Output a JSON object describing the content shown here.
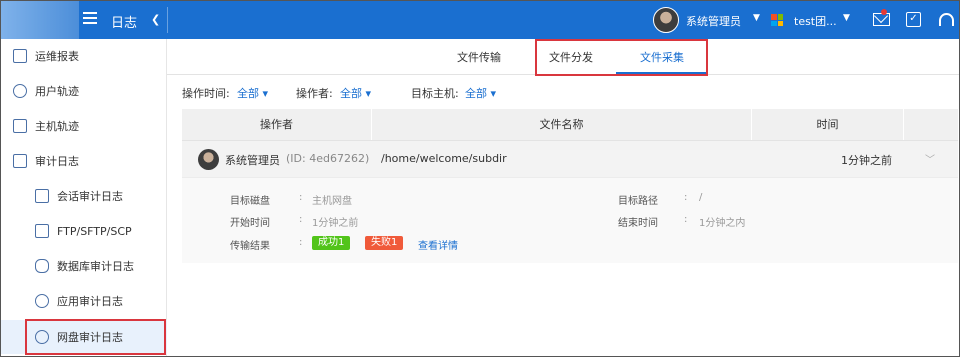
{
  "header": {
    "app_title": "日志",
    "user_name": "系统管理员",
    "team_name": "test团...",
    "colors": {
      "bar": "#1a6fd0",
      "notify_dot": "#e53935"
    }
  },
  "sidebar": {
    "items": [
      {
        "label": "运维报表",
        "icon": "report-icon"
      },
      {
        "label": "用户轨迹",
        "icon": "user-track-icon"
      },
      {
        "label": "主机轨迹",
        "icon": "host-track-icon"
      },
      {
        "label": "审计日志",
        "icon": "audit-log-icon"
      },
      {
        "label": "会话审计日志",
        "icon": "session-icon"
      },
      {
        "label": "FTP/SFTP/SCP",
        "icon": "ftp-icon"
      },
      {
        "label": "数据库审计日志",
        "icon": "database-icon"
      },
      {
        "label": "应用审计日志",
        "icon": "app-icon"
      },
      {
        "label": "网盘审计日志",
        "icon": "cloud-disk-icon"
      }
    ]
  },
  "tabs": [
    {
      "label": "文件传输"
    },
    {
      "label": "文件分发"
    },
    {
      "label": "文件采集"
    }
  ],
  "filters": {
    "op_time_label": "操作时间:",
    "op_time_value": "全部",
    "operator_label": "操作者:",
    "operator_value": "全部",
    "host_label": "目标主机:",
    "host_value": "全部"
  },
  "table": {
    "columns": [
      "操作者",
      "文件名称",
      "时间"
    ],
    "row": {
      "user": "系统管理员",
      "id": "(ID: 4ed67262)",
      "path": "/home/welcome/subdir",
      "time": "1分钟之前"
    },
    "detail": {
      "disk_label": "目标磁盘",
      "disk_value": "主机网盘",
      "path_label": "目标路径",
      "path_value": "/",
      "start_label": "开始时间",
      "start_value": "1分钟之前",
      "end_label": "结束时间",
      "end_value": "1分钟之内",
      "result_label": "传输结果",
      "success": "成功1",
      "fail": "失败1",
      "view_detail": "查看详情",
      "colon": ":",
      "colors": {
        "success": "#52c41a",
        "fail": "#f05a3a"
      }
    }
  }
}
